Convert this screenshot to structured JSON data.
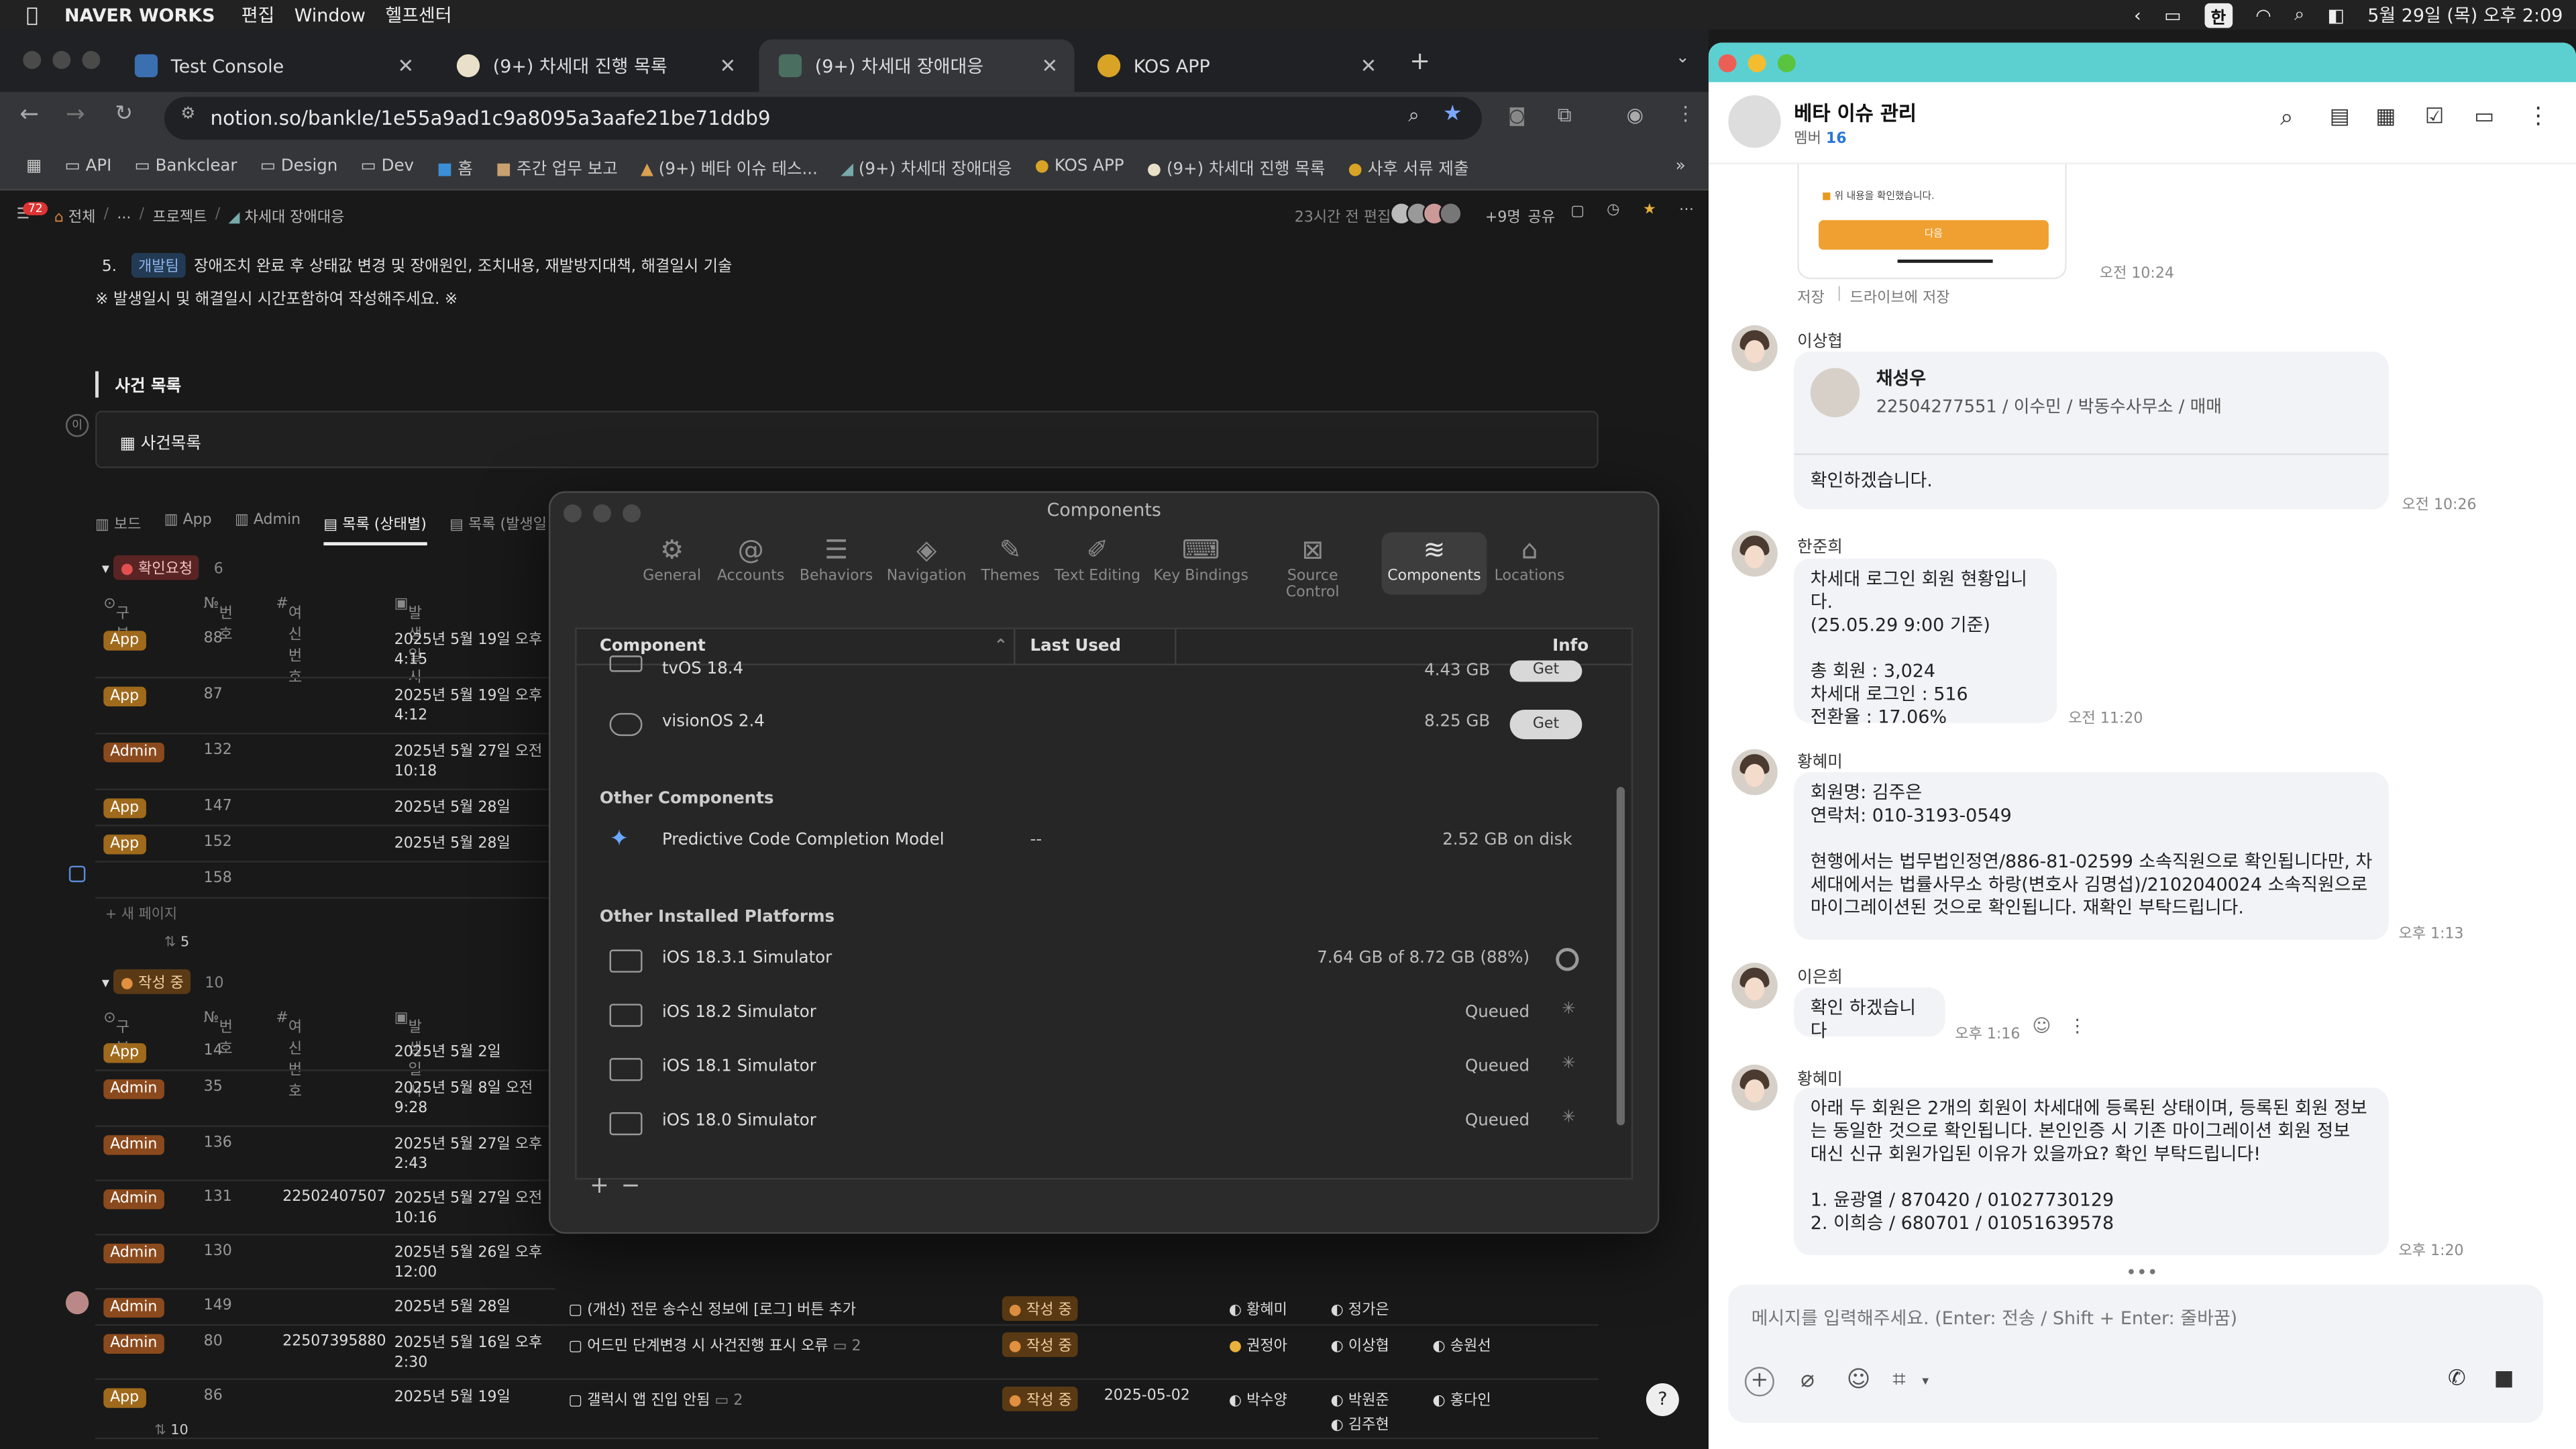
{
  "menubar": {
    "app": "NAVER WORKS",
    "items": [
      "편집",
      "Window",
      "헬프센터"
    ],
    "ime": "한",
    "datetime": "5월 29일 (목) 오후 2:09"
  },
  "browser": {
    "tabs": [
      {
        "label": "Test Console"
      },
      {
        "label": "(9+) 차세대 진행 목록"
      },
      {
        "label": "(9+) 차세대 장애대응"
      },
      {
        "label": "KOS APP"
      }
    ],
    "url": "notion.so/bankle/1e55a9ad1c9a8095a3aafe21be71ddb9",
    "bookmarks": [
      "API",
      "Bankclear",
      "Design",
      "Dev",
      "홈",
      "주간 업무 보고",
      "(9+) 베타 이슈 테스...",
      "(9+) 차세대 장애대응",
      "KOS APP",
      "(9+) 차세대 진행 목록",
      "사후 서류 제출"
    ]
  },
  "notion": {
    "breadcrumb": [
      "전체",
      "...",
      "프로젝트",
      "차세대 장애대응"
    ],
    "notif_count": "72",
    "edited": "23시간 전 편집",
    "more_people": "+9명",
    "share": "공유",
    "line5_num": "5.",
    "line5_tag": "개발팀",
    "line5": "장애조치 완료 후 상태값 변경 및 장애원인, 조치내용, 재발방지대책, 해결일시 기술",
    "note": "※ 발생일시 및 해결일시 시간포함하여 작성해주세요. ※",
    "section_title": "사건 목록",
    "callout": "사건목록",
    "views": [
      "보드",
      "App",
      "Admin",
      "목록 (상태별)",
      "목록 (발생일 기..."
    ],
    "group1": {
      "label": "확인요청",
      "count": "6"
    },
    "cols": [
      "구분",
      "번호",
      "여신번호",
      "발생일시"
    ],
    "rows1": [
      {
        "tag": "App",
        "no": "88",
        "loan": "",
        "date": "2025년 5월 19일 오후 4:15"
      },
      {
        "tag": "App",
        "no": "87",
        "loan": "",
        "date": "2025년 5월 19일 오후 4:12"
      },
      {
        "tag": "Admin",
        "no": "132",
        "loan": "",
        "date": "2025년 5월 27일 오전 10:18"
      },
      {
        "tag": "App",
        "no": "147",
        "loan": "",
        "date": "2025년 5월 28일"
      },
      {
        "tag": "App",
        "no": "152",
        "loan": "",
        "date": "2025년 5월 28일"
      },
      {
        "tag": "",
        "no": "158",
        "loan": "",
        "date": ""
      }
    ],
    "new_page": "새 페이지",
    "count1": "5",
    "group2": {
      "label": "작성 중",
      "count": "10"
    },
    "rows2": [
      {
        "tag": "App",
        "no": "14",
        "loan": "",
        "date": "2025년 5월 2일"
      },
      {
        "tag": "Admin",
        "no": "35",
        "loan": "",
        "date": "2025년 5월 8일 오전 9:28"
      },
      {
        "tag": "Admin",
        "no": "136",
        "loan": "",
        "date": "2025년 5월 27일 오후 2:43"
      },
      {
        "tag": "Admin",
        "no": "131",
        "loan": "22502407507",
        "date": "2025년 5월 27일 오전 10:16"
      },
      {
        "tag": "Admin",
        "no": "130",
        "loan": "",
        "date": "2025년 5월 26일 오후 12:00"
      },
      {
        "tag": "Admin",
        "no": "149",
        "loan": "",
        "date": "2025년 5월 28일"
      },
      {
        "tag": "Admin",
        "no": "80",
        "loan": "22507395880",
        "date": "2025년 5월 16일 오후 2:30"
      },
      {
        "tag": "App",
        "no": "86",
        "loan": "",
        "date": "2025년 5월 19일"
      }
    ],
    "wide_rows": [
      {
        "title": "(개선) 전문 송수신 정보에 [로그] 버튼 추가",
        "status": "작성 중",
        "date2": "",
        "p1": "황혜미",
        "p2": "정가은",
        "p3": ""
      },
      {
        "title": "어드민 단계변경 시 사건진행 표시 오류",
        "comments": "2",
        "status": "작성 중",
        "date2": "",
        "p1": "권정아",
        "p2": "이상협",
        "p3": "송원선"
      },
      {
        "title": "갤럭시 앱 진입 안됨",
        "comments": "2",
        "status": "작성 중",
        "date2": "2025-05-02",
        "p1": "박수양",
        "p2": "박원준",
        "p2b": "김주현",
        "p3": "홍다인"
      }
    ],
    "count2": "10"
  },
  "components": {
    "title": "Components",
    "toolbar": [
      "General",
      "Accounts",
      "Behaviors",
      "Navigation",
      "Themes",
      "Text Editing",
      "Key Bindings",
      "Source Control",
      "Components",
      "Locations"
    ],
    "headers": [
      "Component",
      "Last Used",
      "Info"
    ],
    "platforms": [
      {
        "name": "tvOS 18.4",
        "size": "4.43 GB",
        "action": "Get"
      },
      {
        "name": "visionOS 2.4",
        "size": "8.25 GB",
        "action": "Get"
      }
    ],
    "other_title": "Other Components",
    "other": {
      "name": "Predictive Code Completion Model",
      "last": "--",
      "size": "2.52 GB on disk"
    },
    "installed_title": "Other Installed Platforms",
    "installed": [
      {
        "name": "iOS 18.3.1 Simulator",
        "status": "7.64 GB of 8.72 GB (88%)"
      },
      {
        "name": "iOS 18.2 Simulator",
        "status": "Queued"
      },
      {
        "name": "iOS 18.1 Simulator",
        "status": "Queued"
      },
      {
        "name": "iOS 18.0 Simulator",
        "status": "Queued"
      }
    ],
    "add": "+",
    "remove": "−"
  },
  "chat": {
    "title": "베타 이슈 관리",
    "members_label": "멤버",
    "members": "16",
    "prev_checkbox": "위 내용을 확인했습니다.",
    "prev_button": "다음",
    "prev_time": "오전 10:24",
    "save": "저장",
    "save_drive": "드라이브에 저장",
    "messages": [
      {
        "sender": "이상협",
        "card_name": "채성우",
        "card_info": "22504277551 / 이수민 / 박동수사무소 / 매매",
        "text": "확인하겠습니다.",
        "time": "오전 10:26"
      },
      {
        "sender": "한준희",
        "text": "차세대 로그인 회원 현황입니다.\n(25.05.29 9:00 기준)\n\n총 회원 : 3,024\n차세대 로그인 : 516\n전환율 : 17.06%",
        "time": "오전 11:20"
      },
      {
        "sender": "황혜미",
        "text": "회원명: 김주은\n연락처: 010-3193-0549\n\n현행에서는 법무법인정연/886-81-02599 소속직원으로 확인됩니다만, 차세대에서는 법률사무소 하랑(변호사 김명섭)/2102040024 소속직원으로 마이그레이션된 것으로 확인됩니다. 재확인 부탁드립니다.",
        "time": "오후 1:13"
      },
      {
        "sender": "이은희",
        "text": "확인 하겠습니다",
        "time": "오후 1:16"
      },
      {
        "sender": "황혜미",
        "text": "아래 두 회원은 2개의 회원이 차세대에 등록된 상태이며, 등록된 회원 정보는 동일한 것으로 확인됩니다. 본인인증 시 기존 마이그레이션 회원 정보 대신 신규 회원가입된 이유가 있을까요? 확인 부탁드립니다!\n\n1. 윤광열 / 870420 / 01027730129\n2. 이희승 / 680701 / 01051639578",
        "time": "오후 1:20"
      }
    ],
    "input_placeholder": "메시지를 입력해주세요. (Enter: 전송 / Shift + Enter: 줄바꿈)"
  }
}
